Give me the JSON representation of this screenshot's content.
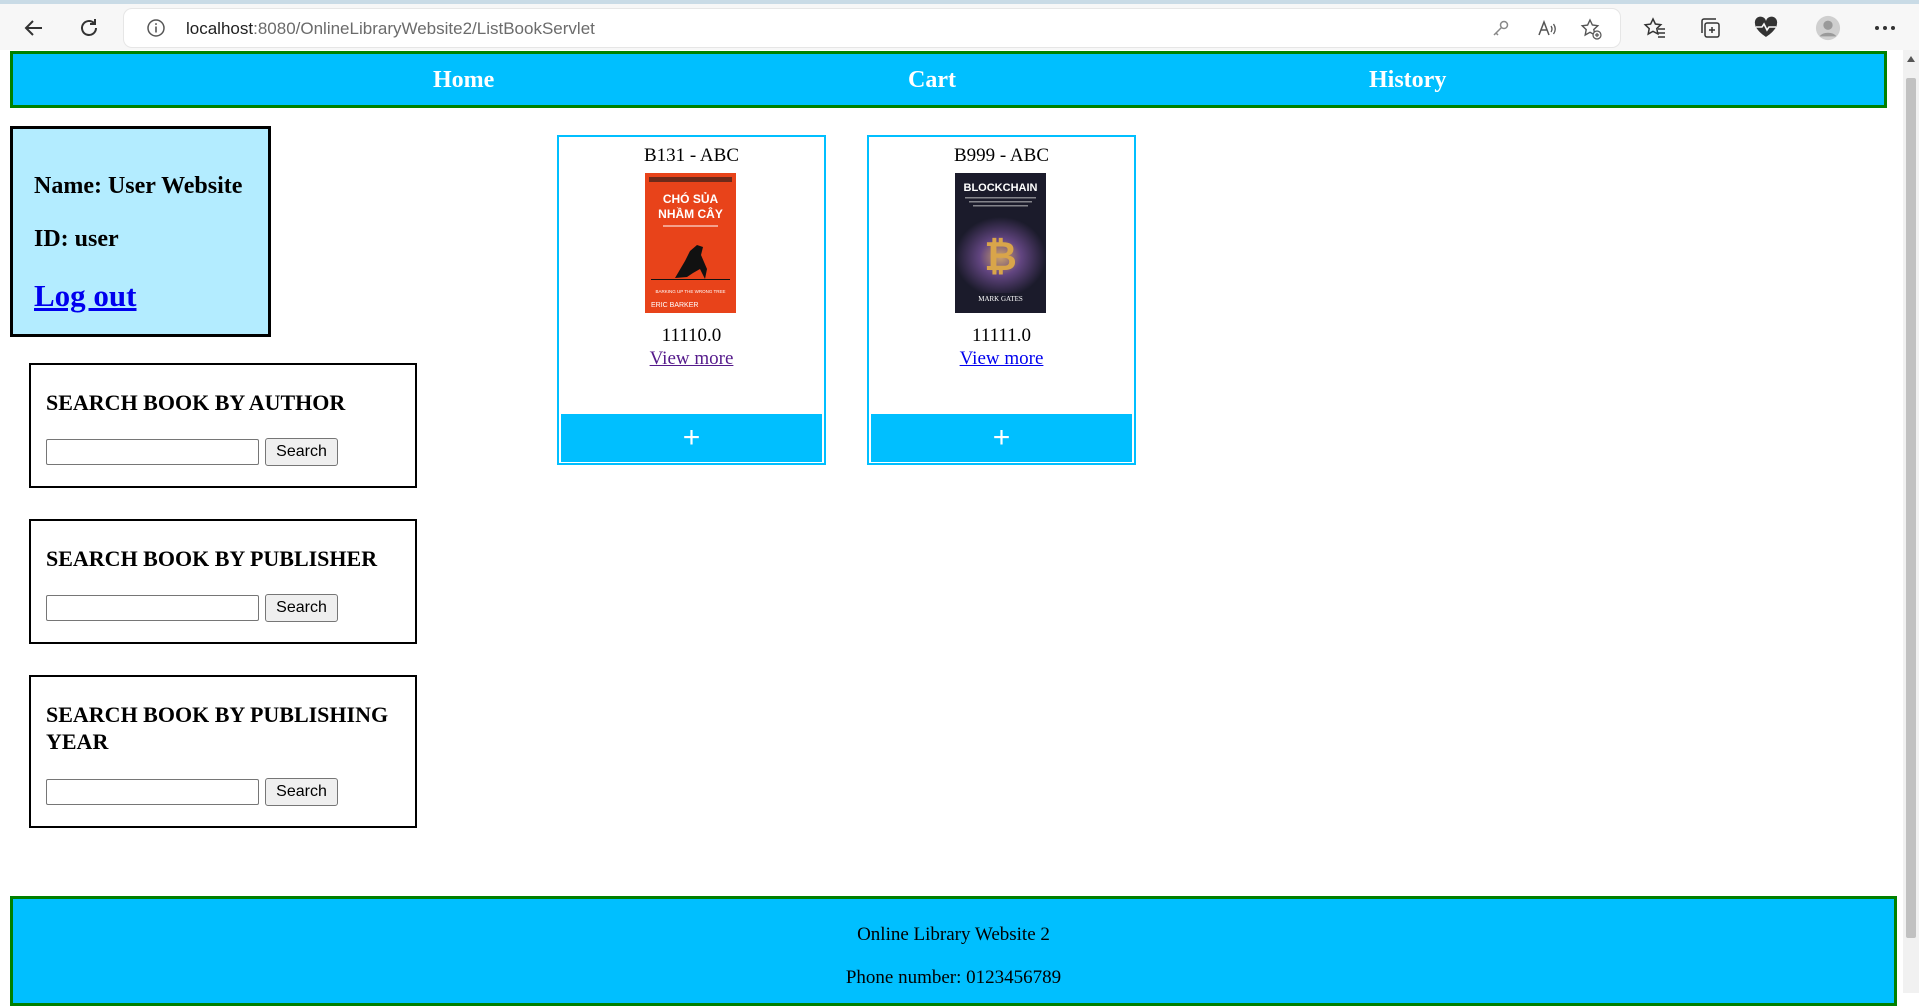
{
  "browser": {
    "url_host": "localhost",
    "url_path": ":8080/OnlineLibraryWebsite2/ListBookServlet",
    "icons": [
      "back-icon",
      "refresh-icon",
      "info-icon",
      "key-icon",
      "read-aloud-icon",
      "add-favorite-icon",
      "favorites-icon",
      "collections-icon",
      "health-icon",
      "profile-icon",
      "more-icon"
    ]
  },
  "nav": {
    "home": "Home",
    "cart": "Cart",
    "history": "History"
  },
  "user": {
    "name": "Name: User Website",
    "id": "ID: user",
    "logout": "Log out"
  },
  "search": {
    "author": {
      "title": "SEARCH BOOK BY AUTHOR",
      "value": "",
      "button": "Search"
    },
    "publisher": {
      "title": "SEARCH BOOK BY PUBLISHER",
      "value": "",
      "button": "Search"
    },
    "year": {
      "title": "SEARCH BOOK BY PUBLISHING YEAR",
      "value": "",
      "button": "Search"
    }
  },
  "books": [
    {
      "title": "B131 - ABC",
      "price": "11110.0",
      "more": "View more",
      "add": "+",
      "cover": {
        "title_line1": "CHÓ SỦA",
        "title_line2": "NHẦM CÂY",
        "subtitle": "BARKING UP THE WRONG TREE",
        "author": "ERIC BARKER",
        "color": "#e8431a"
      }
    },
    {
      "title": "B999 - ABC",
      "price": "11111.0",
      "more": "View more",
      "add": "+",
      "cover": {
        "title_line1": "BLOCKCHAIN",
        "author": "MARK GATES",
        "color": "#1b1b2b"
      }
    }
  ],
  "footer": {
    "name": "Online Library Website 2",
    "phone": "Phone number: 0123456789"
  },
  "colors": {
    "nav_bg": "#00bfff",
    "nav_border": "#008000",
    "user_bg": "#b3ecff",
    "link": "#0000ee",
    "visited": "#551a8b"
  }
}
